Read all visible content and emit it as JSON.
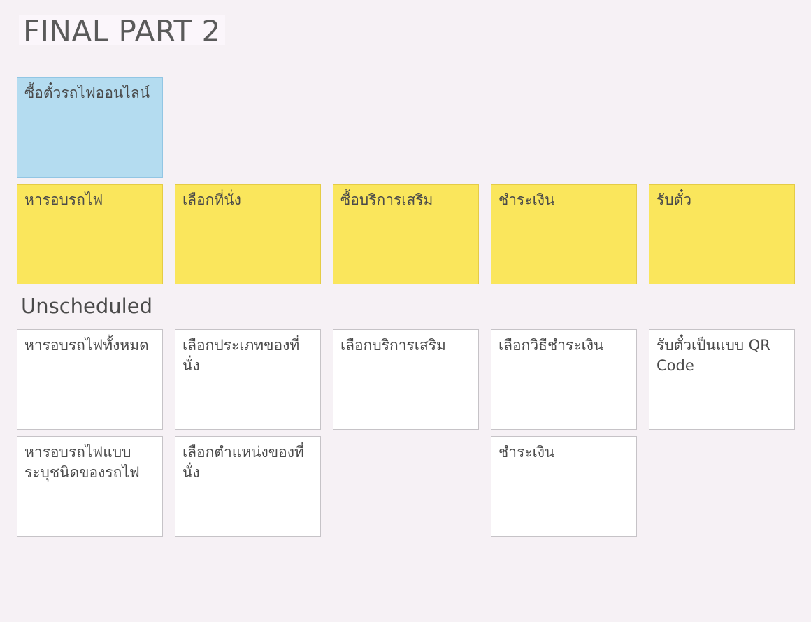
{
  "board": {
    "title": "FINAL PART 2"
  },
  "epic": {
    "label": "ซื้อตั๋วรถไฟออนไลน์"
  },
  "activities": [
    {
      "label": "หารอบรถไฟ"
    },
    {
      "label": "เลือกที่นั่ง"
    },
    {
      "label": "ซื้อบริการเสริม"
    },
    {
      "label": "ชำระเงิน"
    },
    {
      "label": "รับตั๋ว"
    }
  ],
  "unscheduled": {
    "title": "Unscheduled",
    "row1": [
      {
        "label": "หารอบรถไฟทั้งหมด"
      },
      {
        "label": "เลือกประเภทของที่นั่ง"
      },
      {
        "label": "เลือกบริการเสริม"
      },
      {
        "label": "เลือกวิธีชำระเงิน"
      },
      {
        "label": "รับตั๋วเป็นแบบ QR Code"
      }
    ],
    "row2": [
      {
        "label": "หารอบรถไฟแบบระบุชนิดของรถไฟ"
      },
      {
        "label": "เลือกตำแหน่งของที่นั่ง"
      },
      {
        "label": "ชำระเงิน"
      }
    ]
  }
}
